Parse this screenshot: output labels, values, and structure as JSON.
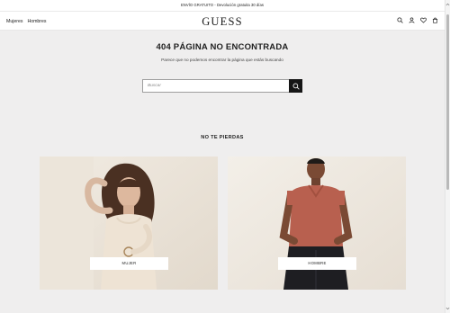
{
  "promo": {
    "text": "ENVÍO GRATUITO - Devolución gratuita 30 días"
  },
  "header": {
    "logo": "GUESS",
    "nav": [
      {
        "label": "Mujeres"
      },
      {
        "label": "Hombres"
      }
    ],
    "icons": [
      "search-icon",
      "account-icon",
      "wishlist-icon",
      "cart-icon"
    ]
  },
  "main": {
    "title": "404 PÁGINA NO ENCONTRADA",
    "subtitle": "Parece que no podemos encontrar la página que estás buscando",
    "search": {
      "placeholder": "Buscar",
      "value": ""
    },
    "section_title": "NO TE PIERDAS",
    "cards": [
      {
        "label": "MUJER",
        "bg": "#e9e2d6",
        "accent": "#e8dccb"
      },
      {
        "label": "HOMBRE",
        "bg": "#efe9e0",
        "accent": "#b8604f"
      }
    ]
  },
  "colors": {
    "accent": "#161616",
    "page_bg": "#efeeee"
  }
}
